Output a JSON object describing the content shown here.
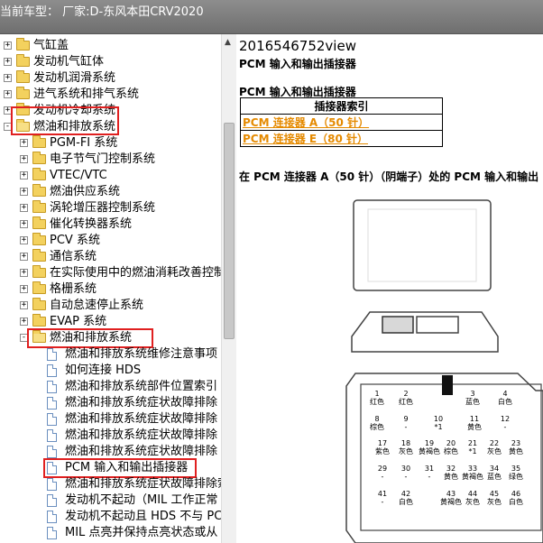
{
  "header": {
    "title": "当前车型：  厂家:D-东风本田CRV2020"
  },
  "tree": {
    "items": [
      {
        "label": "气缸盖",
        "type": "folder",
        "level": 0,
        "expander": "+"
      },
      {
        "label": "发动机气缸体",
        "type": "folder",
        "level": 0,
        "expander": "+"
      },
      {
        "label": "发动机润滑系统",
        "type": "folder",
        "level": 0,
        "expander": "+"
      },
      {
        "label": "进气系统和排气系统",
        "type": "folder",
        "level": 0,
        "expander": "+"
      },
      {
        "label": "发动机冷却系统",
        "type": "folder",
        "level": 0,
        "expander": "+"
      },
      {
        "label": "燃油和排放系统",
        "type": "folder",
        "level": 0,
        "expander": "-",
        "highlighted": true
      },
      {
        "label": "PGM-FI 系统",
        "type": "folder",
        "level": 1,
        "expander": "+"
      },
      {
        "label": "电子节气门控制系统",
        "type": "folder",
        "level": 1,
        "expander": "+"
      },
      {
        "label": "VTEC/VTC",
        "type": "folder",
        "level": 1,
        "expander": "+"
      },
      {
        "label": "燃油供应系统",
        "type": "folder",
        "level": 1,
        "expander": "+"
      },
      {
        "label": "涡轮增压器控制系统",
        "type": "folder",
        "level": 1,
        "expander": "+"
      },
      {
        "label": "催化转换器系统",
        "type": "folder",
        "level": 1,
        "expander": "+"
      },
      {
        "label": "PCV 系统",
        "type": "folder",
        "level": 1,
        "expander": "+"
      },
      {
        "label": "通信系统",
        "type": "folder",
        "level": 1,
        "expander": "+"
      },
      {
        "label": "在实际使用中的燃油消耗改善控制",
        "type": "folder",
        "level": 1,
        "expander": "+"
      },
      {
        "label": "格栅系统",
        "type": "folder",
        "level": 1,
        "expander": "+"
      },
      {
        "label": "自动怠速停止系统",
        "type": "folder",
        "level": 1,
        "expander": "+"
      },
      {
        "label": "EVAP 系统",
        "type": "folder",
        "level": 1,
        "expander": "+"
      },
      {
        "label": "燃油和排放系统",
        "type": "folder",
        "level": 1,
        "expander": "-",
        "highlighted": true
      },
      {
        "label": "燃油和排放系统维修注意事项",
        "type": "doc",
        "level": 2
      },
      {
        "label": "如何连接 HDS",
        "type": "doc",
        "level": 2
      },
      {
        "label": "燃油和排放系统部件位置索引",
        "type": "doc",
        "level": 2
      },
      {
        "label": "燃油和排放系统症状故障排除",
        "type": "doc",
        "level": 2
      },
      {
        "label": "燃油和排放系统症状故障排除",
        "type": "doc",
        "level": 2
      },
      {
        "label": "燃油和排放系统症状故障排除",
        "type": "doc",
        "level": 2
      },
      {
        "label": "燃油和排放系统症状故障排除",
        "type": "doc",
        "level": 2
      },
      {
        "label": "PCM 输入和输出插接器",
        "type": "doc",
        "level": 2,
        "highlighted": true
      },
      {
        "label": "燃油和排放系统症状故障排除索引",
        "type": "doc",
        "level": 2
      },
      {
        "label": "发动机不起动（MIL 工作正常",
        "type": "doc",
        "level": 2
      },
      {
        "label": "发动机不起动且 HDS 不与 PC",
        "type": "doc",
        "level": 2
      },
      {
        "label": "MIL 点亮并保持点亮状态或从",
        "type": "doc",
        "level": 2
      }
    ]
  },
  "content": {
    "title": "2016546752view",
    "heading": "PCM 输入和输出插接器",
    "subheading": "PCM 输入和输出插接器",
    "table_header": "插接器索引",
    "links": [
      "PCM 连接器 A（50 针）",
      "PCM 连接器 E（80 针）"
    ],
    "section": "在 PCM 连接器 A（50 针）（阴端子）处的 PCM 输入和输出",
    "pins": [
      {
        "num": "1",
        "color": "红色"
      },
      {
        "num": "2",
        "color": "红色"
      },
      {
        "num": "3",
        "color": "蓝色"
      },
      {
        "num": "4",
        "color": "白色"
      },
      {
        "num": "8",
        "color": "棕色"
      },
      {
        "num": "9",
        "color": "-"
      },
      {
        "num": "10",
        "color": "*1"
      },
      {
        "num": "11",
        "color": "黄色"
      },
      {
        "num": "12",
        "color": "-"
      },
      {
        "num": "17",
        "color": "紫色"
      },
      {
        "num": "18",
        "color": "灰色"
      },
      {
        "num": "19",
        "color": "黄褐色"
      },
      {
        "num": "20",
        "color": "棕色"
      },
      {
        "num": "21",
        "color": "*1"
      },
      {
        "num": "22",
        "color": "灰色"
      },
      {
        "num": "23",
        "color": "黄色"
      },
      {
        "num": "29",
        "color": "-"
      },
      {
        "num": "30",
        "color": "-"
      },
      {
        "num": "31",
        "color": "-"
      },
      {
        "num": "32",
        "color": "黄色"
      },
      {
        "num": "33",
        "color": "黄褐色"
      },
      {
        "num": "34",
        "color": "蓝色"
      },
      {
        "num": "35",
        "color": "绿色"
      },
      {
        "num": "41",
        "color": "-"
      },
      {
        "num": "42",
        "color": "白色"
      },
      {
        "num": "43",
        "color": "黄褐色"
      },
      {
        "num": "44",
        "color": "灰色"
      },
      {
        "num": "45",
        "color": "灰色"
      },
      {
        "num": "46",
        "color": "白色"
      }
    ]
  },
  "colors": {
    "highlight": "#e02020",
    "link": "#e58a00",
    "header_bg": "#7f7f7f"
  }
}
